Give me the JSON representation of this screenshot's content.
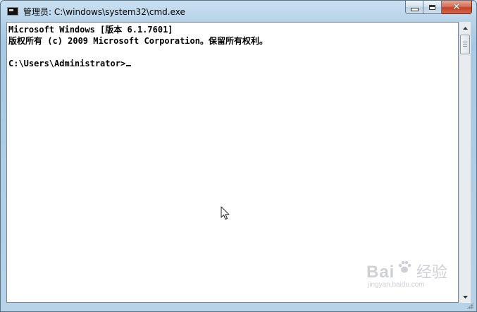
{
  "window": {
    "title": "管理员: C:\\windows\\system32\\cmd.exe",
    "minimize_label": "",
    "maximize_label": "",
    "close_label": "✕"
  },
  "console": {
    "lines": [
      "Microsoft Windows [版本 6.1.7601]",
      "版权所有 (c) 2009 Microsoft Corporation。保留所有权利。",
      "",
      "C:\\Users\\Administrator>"
    ]
  },
  "watermark": {
    "logo": "Bai",
    "sub": "经验",
    "url": "jingyan.baidu.com"
  },
  "icons": {
    "app": "cmd-icon",
    "pointer": "mouse-pointer-icon"
  }
}
